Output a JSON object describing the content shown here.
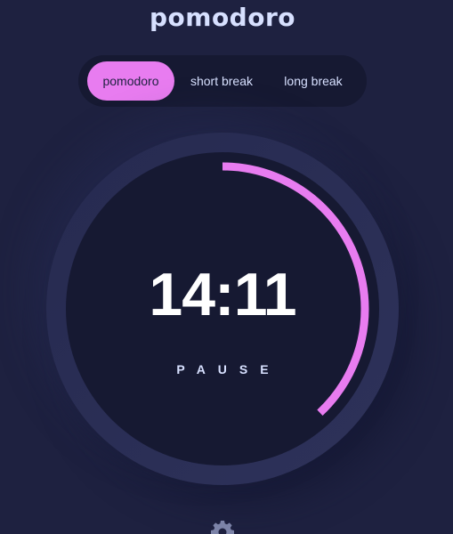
{
  "app": {
    "title": "pomodoro"
  },
  "tabs": [
    {
      "label": "pomodoro",
      "active": true
    },
    {
      "label": "short break",
      "active": false
    },
    {
      "label": "long break",
      "active": false
    }
  ],
  "timer": {
    "time": "14:11",
    "action": "PAUSE",
    "remaining_fraction": 0.38
  },
  "icons": {
    "settings": "gear-icon"
  },
  "colors": {
    "background": "#1e2140",
    "panel": "#161932",
    "accent": "#e87cf0",
    "text": "#d7e0ff"
  }
}
